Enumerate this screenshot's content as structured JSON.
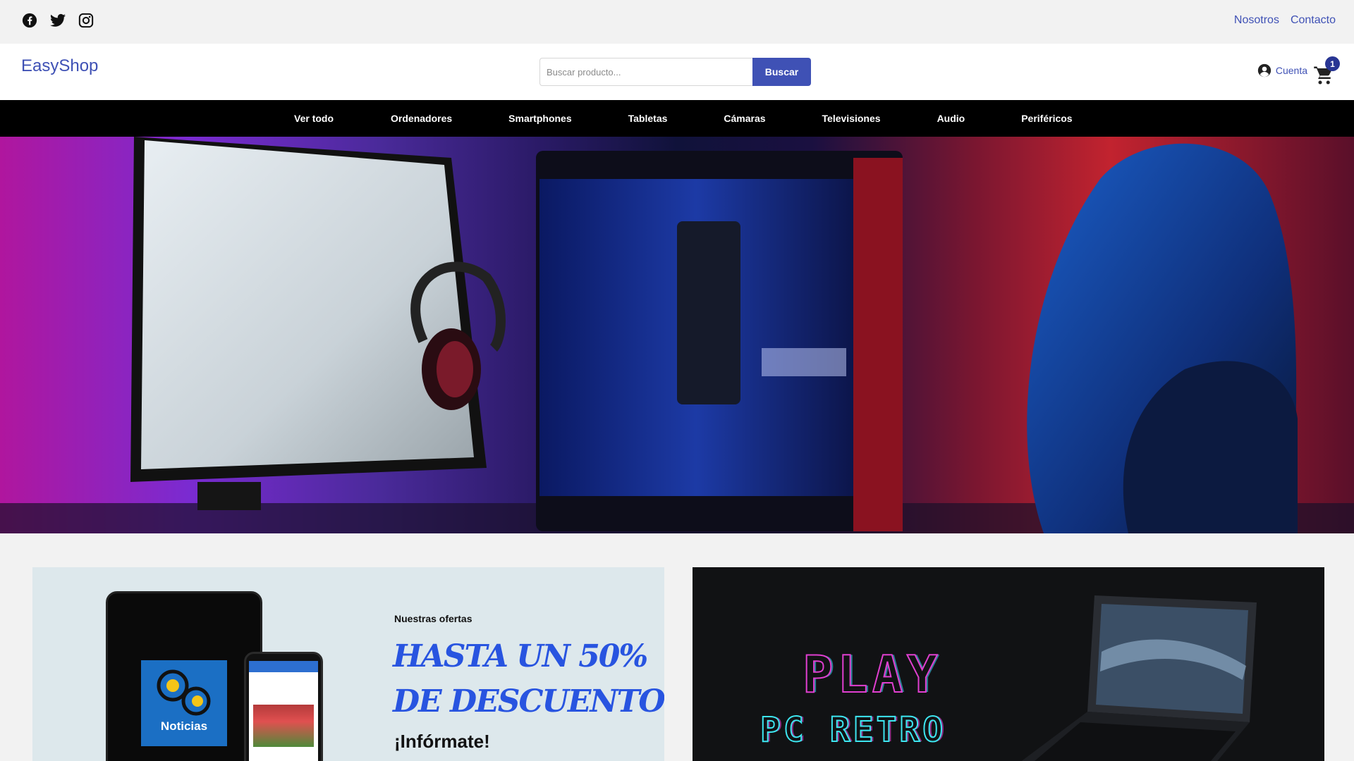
{
  "topbar": {
    "social": [
      {
        "icon": "facebook-icon"
      },
      {
        "icon": "twitter-icon"
      },
      {
        "icon": "instagram-icon"
      }
    ],
    "links": [
      "Nosotros",
      "Contacto"
    ]
  },
  "header": {
    "logo": "EasyShop",
    "search": {
      "placeholder": "Buscar producto...",
      "value": "",
      "button": "Buscar"
    },
    "account_label": "Cuenta",
    "cart_count": "1"
  },
  "nav": {
    "items": [
      "Ver todo",
      "Ordenadores",
      "Smartphones",
      "Tabletas",
      "Cámaras",
      "Televisiones",
      "Audio",
      "Periféricos"
    ]
  },
  "hero": {
    "image_icon": "gaming-setup-banner"
  },
  "promo_left": {
    "tile_label": "Noticias",
    "eyebrow": "Nuestras ofertas",
    "headline_line1": "HASTA UN 50%",
    "headline_line2": "DE DESCUENTO",
    "cta": "¡Infórmate!"
  },
  "promo_right": {
    "title_line1": "PLAY",
    "title_line2": "PC RETRO"
  },
  "colors": {
    "brand": "#3f51b5",
    "nav_bg": "#000000",
    "offer_blue": "#2854e0"
  }
}
